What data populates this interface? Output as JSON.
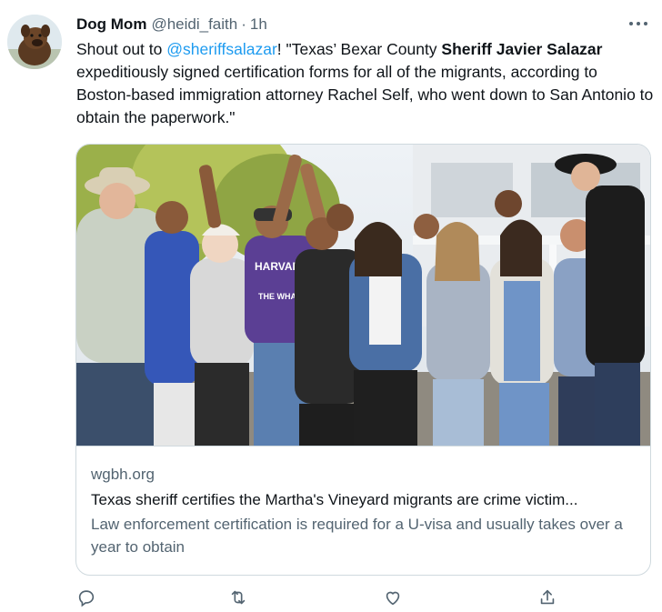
{
  "tweet": {
    "author_name": "Dog Mom",
    "author_handle": "@heidi_faith",
    "separator": "·",
    "time": "1h",
    "text_prefix": "Shout out to ",
    "mention": "@sheriffsalazar",
    "text_mid": "! \"Texas’ Bexar County ",
    "bold_name": "Sheriff Javier Salazar",
    "text_suffix": " expeditiously signed certification forms for all of the migrants, according to Boston-based immigration attorney Rachel Self, who went down to San Antonio to obtain the paperwork.\""
  },
  "card": {
    "domain": "wgbh.org",
    "title": "Texas sheriff certifies the Martha's Vineyard migrants are crime victim...",
    "description": "Law enforcement certification is required for a U-visa and usually takes over a year to obtain",
    "photo_texts": {
      "shirt_text_1": "HARVARD",
      "shirt_text_2": "THE WHALE"
    }
  },
  "actions": {
    "icons": [
      "reply-icon",
      "retweet-icon",
      "like-icon",
      "share-icon"
    ]
  },
  "colors": {
    "link": "#1d9bf0",
    "secondary_text": "#536471",
    "border": "#cfd9de"
  }
}
